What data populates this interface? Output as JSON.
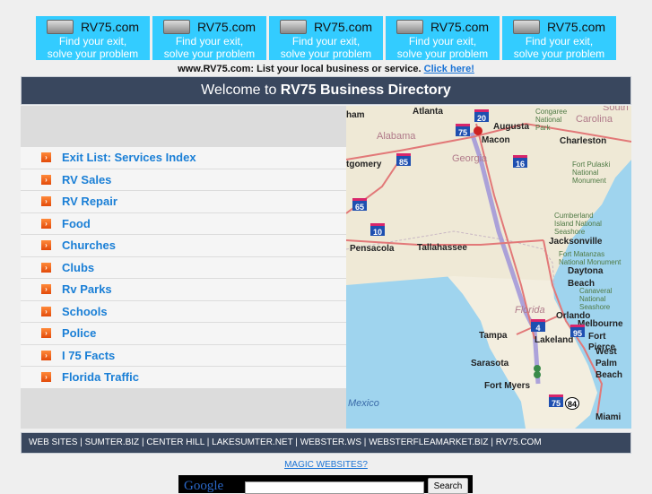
{
  "banners": [
    {
      "brand": "RV75.com",
      "line1": "Find your exit,",
      "line2": "solve your problem"
    },
    {
      "brand": "RV75.com",
      "line1": "Find your exit,",
      "line2": "solve your problem"
    },
    {
      "brand": "RV75.com",
      "line1": "Find your exit,",
      "line2": "solve your problem"
    },
    {
      "brand": "RV75.com",
      "line1": "Find your exit,",
      "line2": "solve your problem"
    },
    {
      "brand": "RV75.com",
      "line1": "Find your exit,",
      "line2": "solve your problem"
    }
  ],
  "promo": {
    "text": "www.RV75.com: List your local business or service. ",
    "link": "Click here!"
  },
  "header": {
    "prefix": "Welcome to ",
    "title": "RV75 Business Directory"
  },
  "menu": [
    "Exit List: Services Index",
    "RV Sales",
    "RV Repair",
    "Food",
    "Churches",
    "Clubs",
    "Rv Parks",
    "Schools",
    "Police",
    "I 75 Facts",
    "Florida Traffic"
  ],
  "map": {
    "cities": [
      "Atlanta",
      "Augusta",
      "Charleston",
      "Macon",
      "tgomery",
      "Jacksonville",
      "Tallahassee",
      "Pensacola",
      "Daytona",
      "Beach",
      "Orlando",
      "Melbourne",
      "Tampa",
      "Lakeland",
      "Fort",
      "Pierce",
      "West",
      "Palm",
      "Beach",
      "Sarasota",
      "Fort Myers",
      "Miami",
      "ham"
    ],
    "states": [
      "Alabama",
      "Georgia",
      "Florida",
      "Mexico",
      "South",
      "Carolina"
    ],
    "shields": [
      "20",
      "75",
      "85",
      "16",
      "65",
      "10",
      "4",
      "95",
      "75",
      "84"
    ],
    "parks": [
      "Congaree National Park",
      "Fort Pulaski National Monument",
      "Cumberland Island National Seashore",
      "Fort Matanzas National Monument",
      "Canaveral National Seashore"
    ]
  },
  "footer": {
    "links": [
      "WEB SITES",
      "SUMTER.BIZ",
      "CENTER HILL",
      "LAKESUMTER.NET",
      "WEBSTER.WS",
      "WEBSTERFLEAMARKET.BIZ",
      "RV75.COM"
    ]
  },
  "magic": "MAGIC WEBSITES?",
  "search": {
    "logo": "Google",
    "button": "Search",
    "value": ""
  }
}
